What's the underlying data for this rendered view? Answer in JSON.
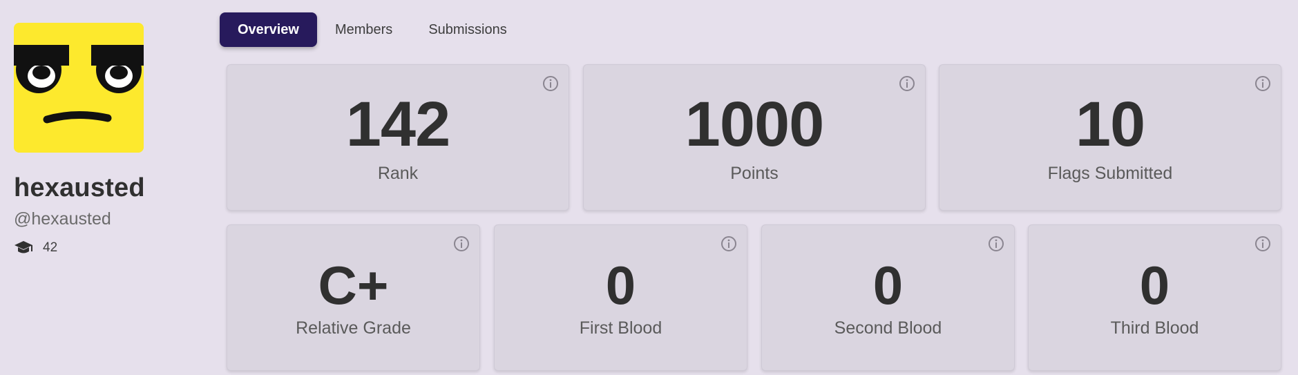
{
  "profile": {
    "name": "hexausted",
    "handle": "@hexausted",
    "member_count": "42",
    "avatar_icon": "unamused-face",
    "avatar_color": "#fde92d"
  },
  "tabs": [
    {
      "label": "Overview",
      "active": true
    },
    {
      "label": "Members",
      "active": false
    },
    {
      "label": "Submissions",
      "active": false
    }
  ],
  "stats_row1": [
    {
      "value": "142",
      "label": "Rank"
    },
    {
      "value": "1000",
      "label": "Points"
    },
    {
      "value": "10",
      "label": "Flags Submitted"
    }
  ],
  "stats_row2": [
    {
      "value": "C+",
      "label": "Relative Grade"
    },
    {
      "value": "0",
      "label": "First Blood"
    },
    {
      "value": "0",
      "label": "Second Blood"
    },
    {
      "value": "0",
      "label": "Third Blood"
    }
  ],
  "colors": {
    "background": "#e6e0ec",
    "card": "#dad5e0",
    "active_tab": "#271a5c"
  }
}
